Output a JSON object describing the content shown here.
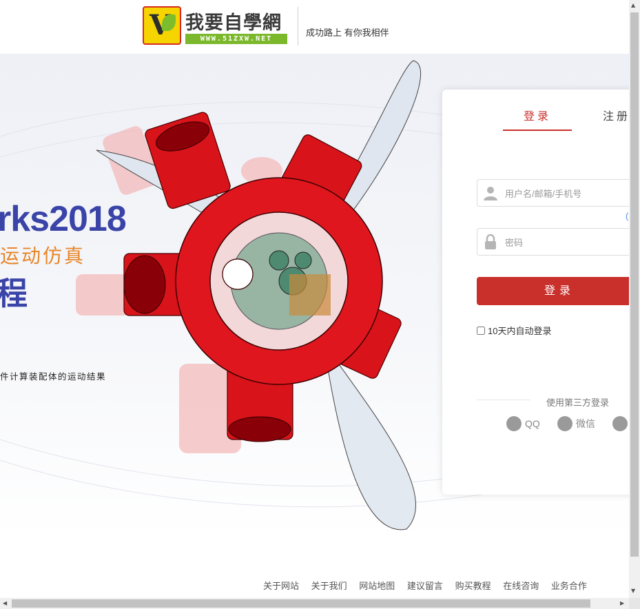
{
  "header": {
    "logo_text": "我要自學網",
    "logo_url_text": "WWW.51ZXW.NET",
    "slogan": "成功路上 有你我相伴"
  },
  "banner": {
    "title": "rks2018",
    "subtitle": "运动仿真",
    "big_text": "程",
    "description": "件计算装配体的运动结果"
  },
  "login": {
    "tab_login": "登录",
    "tab_register": "注册",
    "username_placeholder": "用户名/邮箱/手机号",
    "password_placeholder": "密码",
    "forgot_partial": "(",
    "submit_label": "登录",
    "remember_label": "10天内自动登录",
    "third_party_title": "使用第三方登录",
    "social": [
      {
        "label": "QQ",
        "icon": "qq-icon"
      },
      {
        "label": "微信",
        "icon": "wechat-icon"
      },
      {
        "label": "",
        "icon": "weibo-icon"
      }
    ],
    "accent_color": "#c9302c"
  },
  "footer": {
    "links": [
      "关于网站",
      "关于我们",
      "网站地图",
      "建议留言",
      "购买教程",
      "在线咨询",
      "业务合作"
    ]
  }
}
